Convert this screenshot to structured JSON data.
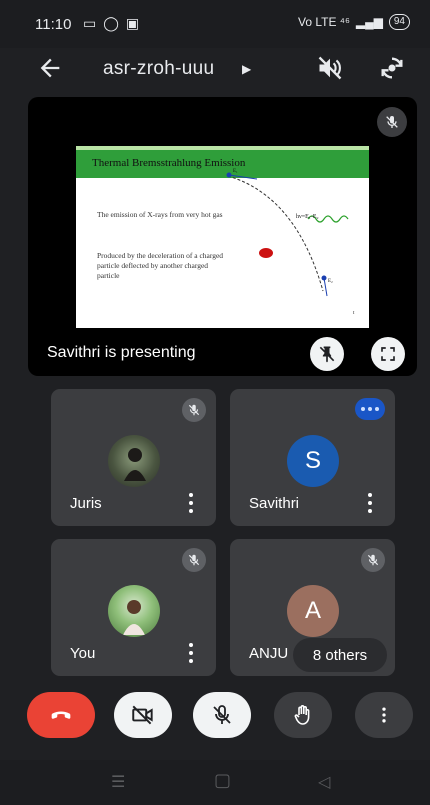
{
  "status": {
    "time": "11:10",
    "network": "Vo LTE ⁴⁶",
    "battery": "94"
  },
  "header": {
    "meeting_code": "asr-zroh-uuu"
  },
  "presentation": {
    "slide": {
      "title": "Thermal Bremsstrahlung Emission",
      "text_1": "The emission of X-rays from very hot gas",
      "text_2": "Produced by the deceleration of a charged particle deflected by another charged particle",
      "equation": "hν=E₁-E₂"
    },
    "presenter_label": "Savithri is presenting"
  },
  "participants": [
    {
      "name": "Juris",
      "muted": true
    },
    {
      "name": "Savithri",
      "speaking": true,
      "initial": "S",
      "avatar_color": "#1a5bb0"
    },
    {
      "name": "You",
      "muted": true
    },
    {
      "name": "ANJU",
      "muted": true,
      "initial": "A",
      "avatar_color": "#9b6f5f"
    }
  ],
  "others_chip": "8 others",
  "colors": {
    "end_call": "#ea4335",
    "tile_bg": "#3c3d40",
    "speaking_badge": "#1a56c7",
    "slide_header": "#2f9e3a"
  },
  "icons": {
    "back": "arrow-left-icon",
    "audio_off": "speaker-off-icon",
    "switch_camera": "camera-switch-icon",
    "unpin": "pin-off-icon",
    "fullscreen": "fullscreen-icon",
    "end_call": "phone-hangup-icon",
    "camera_off": "videocam-off-icon",
    "mic_off": "mic-off-icon",
    "raise_hand": "hand-icon",
    "more": "more-vert-icon"
  }
}
